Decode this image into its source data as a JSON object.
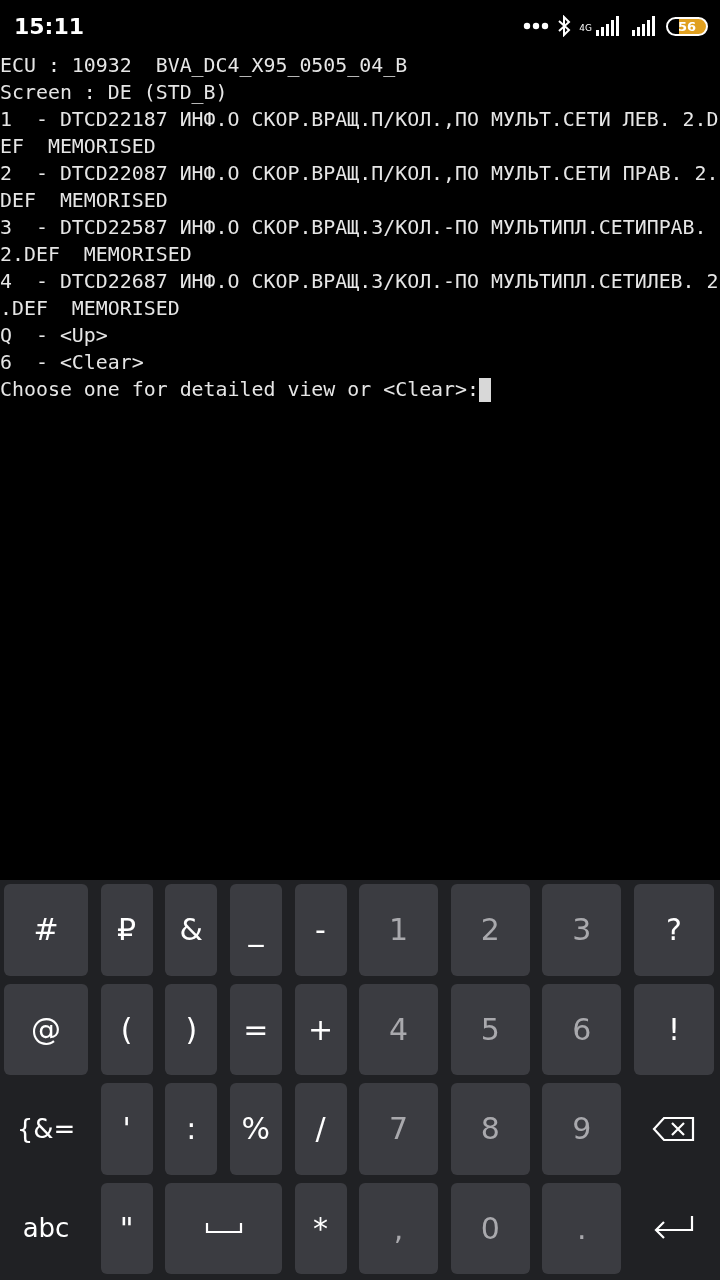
{
  "status_bar": {
    "time": "15:11",
    "network": "4G",
    "battery": "56"
  },
  "terminal": {
    "lines": [
      "ECU : 10932  BVA_DC4_X95_0505_04_B",
      "Screen : DE (STD_B)",
      "1  - DTCD22187 ИНФ.О СКОР.ВРАЩ.П/КОЛ.,ПО МУЛЬТ.СЕТИ ЛЕВ. 2.D",
      "EF  MEMORISED",
      "2  - DTCD22087 ИНФ.О СКОР.ВРАЩ.П/КОЛ.,ПО МУЛЬТ.СЕТИ ПРАВ. 2.",
      "DEF  MEMORISED",
      "3  - DTCD22587 ИНФ.О СКОР.ВРАЩ.З/КОЛ.-ПО МУЛЬТИПЛ.СЕТИПРАВ.",
      "2.DEF  MEMORISED",
      "4  - DTCD22687 ИНФ.О СКОР.ВРАЩ.З/КОЛ.-ПО МУЛЬТИПЛ.СЕТИЛЕВ. 2",
      ".DEF  MEMORISED",
      "Q  - <Up>",
      "6  - <Clear>"
    ],
    "prompt": "Choose one for detailed view or <Clear>:"
  },
  "keyboard": {
    "keys": [
      {
        "kind": "symbol",
        "label": "#"
      },
      {
        "kind": "symbol",
        "label": "₽"
      },
      {
        "kind": "symbol",
        "label": "&"
      },
      {
        "kind": "symbol",
        "label": "_"
      },
      {
        "kind": "symbol",
        "label": "-"
      },
      {
        "kind": "digit",
        "label": "1"
      },
      {
        "kind": "digit",
        "label": "2"
      },
      {
        "kind": "digit",
        "label": "3"
      },
      {
        "kind": "symbol",
        "label": "?"
      },
      {
        "kind": "symbol",
        "label": "@"
      },
      {
        "kind": "symbol",
        "label": "("
      },
      {
        "kind": "symbol",
        "label": ")"
      },
      {
        "kind": "symbol",
        "label": "="
      },
      {
        "kind": "symbol",
        "label": "+"
      },
      {
        "kind": "digit",
        "label": "4"
      },
      {
        "kind": "digit",
        "label": "5"
      },
      {
        "kind": "digit",
        "label": "6"
      },
      {
        "kind": "symbol",
        "label": "!"
      },
      {
        "kind": "mode",
        "label": "{&="
      },
      {
        "kind": "symbol",
        "label": "'"
      },
      {
        "kind": "symbol",
        "label": ":"
      },
      {
        "kind": "symbol",
        "label": "%"
      },
      {
        "kind": "symbol",
        "label": "/"
      },
      {
        "kind": "digit",
        "label": "7"
      },
      {
        "kind": "digit",
        "label": "8"
      },
      {
        "kind": "digit",
        "label": "9"
      },
      {
        "kind": "backspace"
      },
      {
        "kind": "mode",
        "label": "abc"
      },
      {
        "kind": "symbol",
        "label": "\""
      },
      {
        "kind": "space"
      },
      {
        "kind": "symbol",
        "label": "*"
      },
      {
        "kind": "digit",
        "label": ","
      },
      {
        "kind": "digit",
        "label": "0"
      },
      {
        "kind": "digit",
        "label": "."
      },
      {
        "kind": "enter"
      }
    ]
  }
}
